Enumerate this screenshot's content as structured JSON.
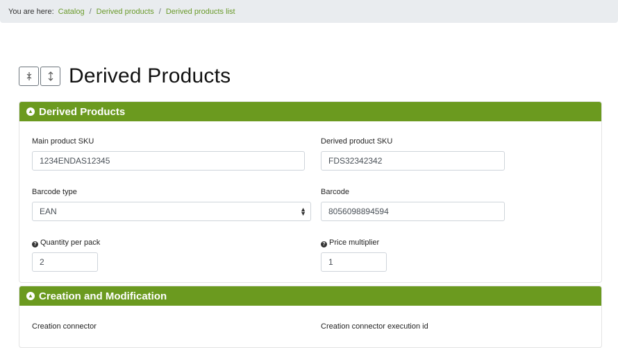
{
  "breadcrumb": {
    "prefix": "You are here:",
    "items": [
      "Catalog",
      "Derived products",
      "Derived products list"
    ],
    "separator": "/"
  },
  "header": {
    "title": "Derived Products",
    "collapse_icon": "collapse-all-icon",
    "expand_icon": "expand-all-icon"
  },
  "sections": {
    "derived": {
      "title": "Derived Products",
      "fields": {
        "main_sku": {
          "label": "Main product SKU",
          "value": "1234ENDAS12345"
        },
        "derived_sku": {
          "label": "Derived product SKU",
          "value": "FDS32342342"
        },
        "barcode_type": {
          "label": "Barcode type",
          "value": "EAN"
        },
        "barcode": {
          "label": "Barcode",
          "value": "8056098894594"
        },
        "qty_per_pack": {
          "label": "Quantity per pack",
          "value": "2"
        },
        "price_multiplier": {
          "label": "Price multiplier",
          "value": "1"
        }
      }
    },
    "creation": {
      "title": "Creation and Modification",
      "fields": {
        "creation_connector": {
          "label": "Creation connector"
        },
        "creation_exec_id": {
          "label": "Creation connector execution id"
        }
      }
    }
  },
  "colors": {
    "accent": "#6b9a1f",
    "link": "#6a9a2b"
  }
}
